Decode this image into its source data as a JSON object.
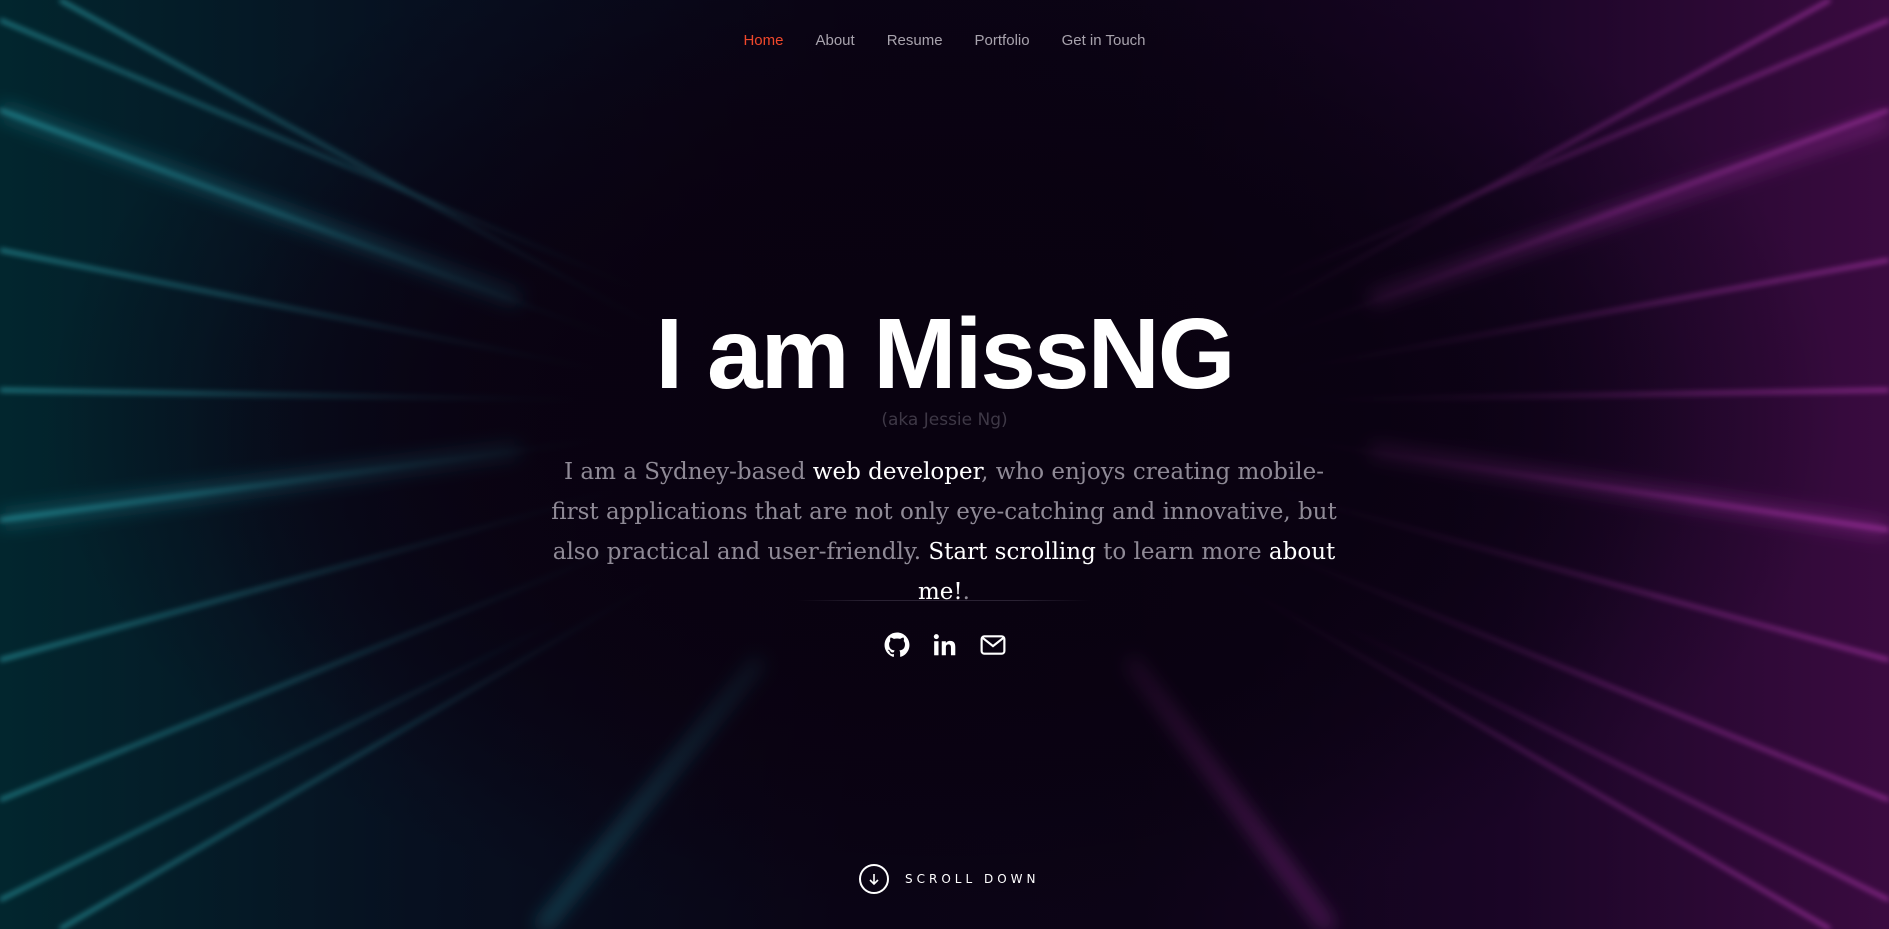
{
  "nav": {
    "items": [
      {
        "label": "Home",
        "active": true
      },
      {
        "label": "About",
        "active": false
      },
      {
        "label": "Resume",
        "active": false
      },
      {
        "label": "Portfolio",
        "active": false
      },
      {
        "label": "Get in Touch",
        "active": false
      }
    ]
  },
  "hero": {
    "title": "I am MissNG",
    "aka": "(aka Jessie Ng)",
    "intro": {
      "part1": "I am a Sydney-based ",
      "link1": "web developer",
      "part2": ", who enjoys creating mobile-first applications that are not only eye-catching and innovative, but also practical and user-friendly. ",
      "link2": "Start scrolling",
      "part3": " to learn more ",
      "link3": "about me!",
      "part4": "."
    }
  },
  "socials": [
    {
      "icon": "github-icon"
    },
    {
      "icon": "linkedin-icon"
    },
    {
      "icon": "mail-icon"
    }
  ],
  "scroll": {
    "label": "SCROLL DOWN",
    "icon": "arrow-down-circle-icon"
  },
  "colors": {
    "accent": "#f0482b",
    "background": "#0b0314",
    "teal_beam": "#2fb8c4",
    "magenta_beam": "#c23ac4"
  }
}
